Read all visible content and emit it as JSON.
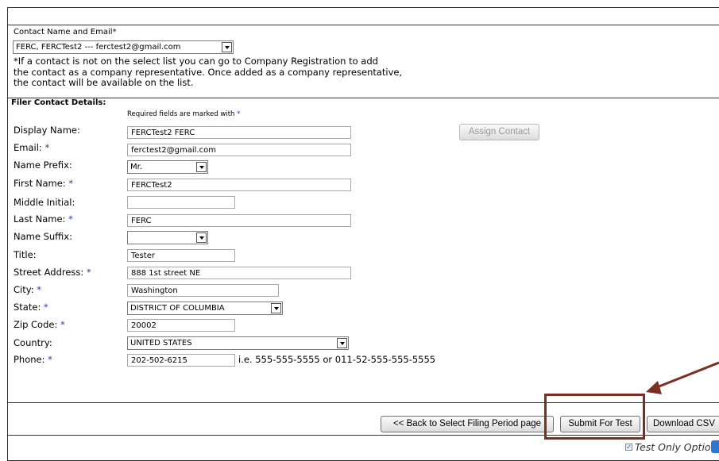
{
  "contact_section": {
    "label": "Contact Name and Email",
    "required_mark": "*",
    "selected_contact": "FERC, FERCTest2 --- ferctest2@gmail.com",
    "note_line1": "*If a contact is not on the select list you can go to Company Registration to add",
    "note_line2": "the contact as a company representative. Once added as a company representative,",
    "note_line3": "the contact will be available on the list."
  },
  "filer": {
    "heading": "Filer Contact Details:",
    "required_note": "Required fields are marked with",
    "required_mark": "*",
    "assign_button": "Assign Contact",
    "fields": {
      "display_name": {
        "label": "Display Name:",
        "value": "FERCTest2 FERC"
      },
      "email": {
        "label": "Email:",
        "value": "ferctest2@gmail.com"
      },
      "name_prefix": {
        "label": "Name Prefix:",
        "value": "Mr."
      },
      "first_name": {
        "label": "First Name:",
        "value": "FERCTest2"
      },
      "middle_initial": {
        "label": "Middle Initial:",
        "value": ""
      },
      "last_name": {
        "label": "Last Name:",
        "value": "FERC"
      },
      "name_suffix": {
        "label": "Name Suffix:",
        "value": ""
      },
      "title": {
        "label": "Title:",
        "value": "Tester"
      },
      "street": {
        "label": "Street Address:",
        "value": "888 1st street NE"
      },
      "city": {
        "label": "City:",
        "value": "Washington"
      },
      "state": {
        "label": "State:",
        "value": "DISTRICT OF COLUMBIA"
      },
      "zip": {
        "label": "Zip Code:",
        "value": "20002"
      },
      "country": {
        "label": "Country:",
        "value": "UNITED STATES"
      },
      "phone": {
        "label": "Phone:",
        "value": "202-502-6215",
        "hint": "i.e. 555-555-5555 or 011-52-555-555-5555"
      }
    }
  },
  "actions": {
    "back_button": "<< Back to Select Filing Period page",
    "submit_button": "Submit For Test",
    "download_button": "Download CSV"
  },
  "footer": {
    "test_only_label": "Test Only Option"
  },
  "colors": {
    "required_star": "#1d3ba8",
    "annotation": "#7a2e24"
  }
}
